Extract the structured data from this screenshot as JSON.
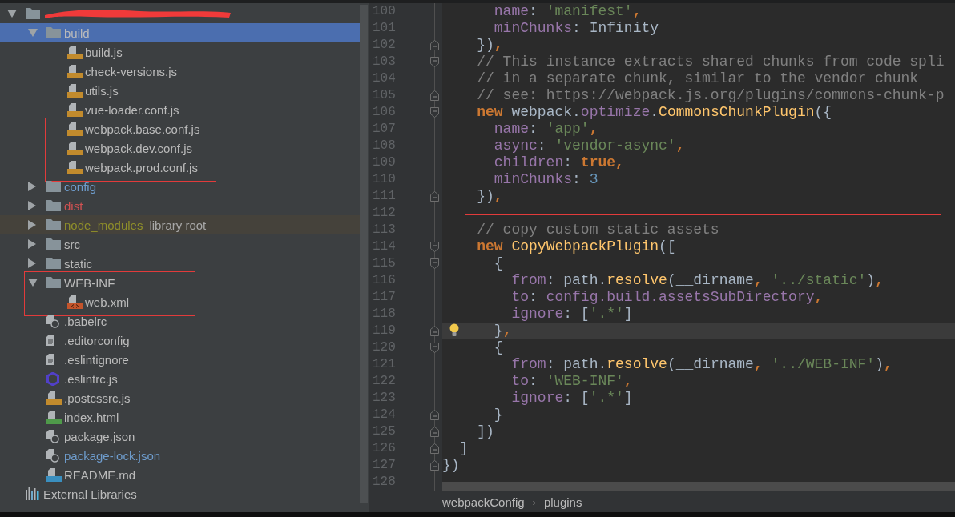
{
  "project_tree": {
    "items": [
      {
        "kind": "folder",
        "redacted": true,
        "expanded": true,
        "selected": false,
        "framed": false,
        "children": [
          {
            "kind": "folder",
            "label": "build",
            "expanded": true,
            "selected": true,
            "framed": false,
            "color": "#bbbbbb",
            "children": [
              {
                "kind": "js",
                "label": "build.js",
                "selected": false,
                "framed": false,
                "color": "#bbbbbb"
              },
              {
                "kind": "js",
                "label": "check-versions.js",
                "selected": false,
                "framed": false,
                "color": "#bbbbbb"
              },
              {
                "kind": "js",
                "label": "utils.js",
                "selected": false,
                "framed": false,
                "color": "#bbbbbb"
              },
              {
                "kind": "js",
                "label": "vue-loader.conf.js",
                "selected": false,
                "framed": false,
                "color": "#bbbbbb"
              },
              {
                "kind": "js",
                "label": "webpack.base.conf.js",
                "selected": false,
                "framed": true,
                "color": "#bbbbbb"
              },
              {
                "kind": "js",
                "label": "webpack.dev.conf.js",
                "selected": false,
                "framed": true,
                "color": "#bbbbbb"
              },
              {
                "kind": "js",
                "label": "webpack.prod.conf.js",
                "selected": false,
                "framed": true,
                "color": "#bbbbbb"
              }
            ]
          },
          {
            "kind": "folder",
            "label": "config",
            "expanded": false,
            "selected": false,
            "framed": false,
            "color": "#6e9ccc"
          },
          {
            "kind": "folder",
            "label": "dist",
            "expanded": false,
            "selected": false,
            "framed": false,
            "color": "#d25252"
          },
          {
            "kind": "folder",
            "label": "node_modules",
            "note": "library root",
            "expanded": false,
            "selected": false,
            "framed": false,
            "color": "#8f8f2a"
          },
          {
            "kind": "folder",
            "label": "src",
            "expanded": false,
            "selected": false,
            "framed": false,
            "color": "#bbbbbb"
          },
          {
            "kind": "folder",
            "label": "static",
            "expanded": false,
            "selected": false,
            "framed": false,
            "color": "#bbbbbb"
          },
          {
            "kind": "folder",
            "label": "WEB-INF",
            "expanded": true,
            "selected": false,
            "framed": true,
            "color": "#bbbbbb",
            "children": [
              {
                "kind": "xml",
                "label": "web.xml",
                "selected": false,
                "framed": true,
                "color": "#bbbbbb"
              }
            ]
          },
          {
            "kind": "config",
            "label": ".babelrc",
            "selected": false,
            "framed": false,
            "color": "#bbbbbb"
          },
          {
            "kind": "text",
            "label": ".editorconfig",
            "selected": false,
            "framed": false,
            "color": "#bbbbbb"
          },
          {
            "kind": "text",
            "label": ".eslintignore",
            "selected": false,
            "framed": false,
            "color": "#bbbbbb"
          },
          {
            "kind": "eslint",
            "label": ".eslintrc.js",
            "selected": false,
            "framed": false,
            "color": "#bbbbbb"
          },
          {
            "kind": "js",
            "label": ".postcssrc.js",
            "selected": false,
            "framed": false,
            "color": "#bbbbbb"
          },
          {
            "kind": "html",
            "label": "index.html",
            "selected": false,
            "framed": false,
            "color": "#bbbbbb"
          },
          {
            "kind": "config",
            "label": "package.json",
            "selected": false,
            "framed": false,
            "color": "#bbbbbb"
          },
          {
            "kind": "config",
            "label": "package-lock.json",
            "selected": false,
            "framed": false,
            "color": "#6e9ccc"
          },
          {
            "kind": "md",
            "label": "README.md",
            "selected": false,
            "framed": false,
            "color": "#bbbbbb"
          }
        ]
      },
      {
        "kind": "libraries",
        "label": "External Libraries",
        "selected": false,
        "framed": false,
        "color": "#bbbbbb"
      }
    ]
  },
  "editor": {
    "blocks": [
      {
        "framed": false,
        "lines": [
          {
            "n": "100",
            "fold_start": false,
            "fold_end": false,
            "current": false,
            "bulb": false,
            "code": [
              {
                "kind": "prop",
                "text": "      name"
              },
              {
                "kind": "plain",
                "text": ": "
              },
              {
                "kind": "str",
                "text": "'manifest'"
              },
              {
                "kind": "kw",
                "text": ","
              }
            ]
          },
          {
            "n": "101",
            "fold_start": false,
            "fold_end": false,
            "current": false,
            "bulb": false,
            "code": [
              {
                "kind": "prop",
                "text": "      minChunks"
              },
              {
                "kind": "plain",
                "text": ": Infinity"
              }
            ]
          },
          {
            "n": "102",
            "fold_start": false,
            "fold_end": true,
            "current": false,
            "bulb": false,
            "code": [
              {
                "kind": "plain",
                "text": "    })"
              },
              {
                "kind": "kw",
                "text": ","
              }
            ]
          },
          {
            "n": "103",
            "fold_start": true,
            "fold_end": false,
            "current": false,
            "bulb": false,
            "code": [
              {
                "kind": "cmt",
                "text": "    // This instance extracts shared chunks from code spli"
              }
            ]
          },
          {
            "n": "104",
            "fold_start": false,
            "fold_end": false,
            "current": false,
            "bulb": false,
            "code": [
              {
                "kind": "cmt",
                "text": "    // in a separate chunk, similar to the vendor chunk"
              }
            ]
          },
          {
            "n": "105",
            "fold_start": false,
            "fold_end": true,
            "current": false,
            "bulb": false,
            "code": [
              {
                "kind": "cmt",
                "text": "    // see: https://webpack.js.org/plugins/commons-chunk-p"
              }
            ]
          },
          {
            "n": "106",
            "fold_start": true,
            "fold_end": false,
            "current": false,
            "bulb": false,
            "code": [
              {
                "kind": "kw",
                "text": "    new"
              },
              {
                "kind": "plain",
                "text": " webpack."
              },
              {
                "kind": "prop",
                "text": "optimize"
              },
              {
                "kind": "plain",
                "text": "."
              },
              {
                "kind": "fn",
                "text": "CommonsChunkPlugin"
              },
              {
                "kind": "plain",
                "text": "({"
              }
            ]
          },
          {
            "n": "107",
            "fold_start": false,
            "fold_end": false,
            "current": false,
            "bulb": false,
            "code": [
              {
                "kind": "prop",
                "text": "      name"
              },
              {
                "kind": "plain",
                "text": ": "
              },
              {
                "kind": "str",
                "text": "'app'"
              },
              {
                "kind": "kw",
                "text": ","
              }
            ]
          },
          {
            "n": "108",
            "fold_start": false,
            "fold_end": false,
            "current": false,
            "bulb": false,
            "code": [
              {
                "kind": "prop",
                "text": "      async"
              },
              {
                "kind": "plain",
                "text": ": "
              },
              {
                "kind": "str",
                "text": "'vendor-async'"
              },
              {
                "kind": "kw",
                "text": ","
              }
            ]
          },
          {
            "n": "109",
            "fold_start": false,
            "fold_end": false,
            "current": false,
            "bulb": false,
            "code": [
              {
                "kind": "prop",
                "text": "      children"
              },
              {
                "kind": "plain",
                "text": ": "
              },
              {
                "kind": "kw",
                "text": "true"
              },
              {
                "kind": "kw",
                "text": ","
              }
            ]
          },
          {
            "n": "110",
            "fold_start": false,
            "fold_end": false,
            "current": false,
            "bulb": false,
            "code": [
              {
                "kind": "prop",
                "text": "      minChunks"
              },
              {
                "kind": "plain",
                "text": ": "
              },
              {
                "kind": "num",
                "text": "3"
              }
            ]
          },
          {
            "n": "111",
            "fold_start": false,
            "fold_end": true,
            "current": false,
            "bulb": false,
            "code": [
              {
                "kind": "plain",
                "text": "    })"
              },
              {
                "kind": "kw",
                "text": ","
              }
            ]
          },
          {
            "n": "112",
            "fold_start": false,
            "fold_end": false,
            "current": false,
            "bulb": false
          }
        ]
      },
      {
        "framed": true,
        "lines": [
          {
            "n": "113",
            "fold_start": false,
            "fold_end": false,
            "current": false,
            "bulb": false,
            "code": [
              {
                "kind": "cmt",
                "text": "    // copy custom static assets"
              }
            ]
          },
          {
            "n": "114",
            "fold_start": true,
            "fold_end": false,
            "current": false,
            "bulb": false,
            "code": [
              {
                "kind": "kw",
                "text": "    new"
              },
              {
                "kind": "fn",
                "text": " CopyWebpackPlugin"
              },
              {
                "kind": "plain",
                "text": "(["
              }
            ]
          },
          {
            "n": "115",
            "fold_start": true,
            "fold_end": false,
            "current": false,
            "bulb": false,
            "code": [
              {
                "kind": "plain",
                "text": "      {"
              }
            ]
          },
          {
            "n": "116",
            "fold_start": false,
            "fold_end": false,
            "current": false,
            "bulb": false,
            "code": [
              {
                "kind": "prop",
                "text": "        from"
              },
              {
                "kind": "plain",
                "text": ": path."
              },
              {
                "kind": "fn",
                "text": "resolve"
              },
              {
                "kind": "plain",
                "text": "(__dirname"
              },
              {
                "kind": "kw",
                "text": ","
              },
              {
                "kind": "str",
                "text": " '../static'"
              },
              {
                "kind": "plain",
                "text": ")"
              },
              {
                "kind": "kw",
                "text": ","
              }
            ]
          },
          {
            "n": "117",
            "fold_start": false,
            "fold_end": false,
            "current": false,
            "bulb": false,
            "code": [
              {
                "kind": "prop",
                "text": "        to"
              },
              {
                "kind": "plain",
                "text": ": "
              },
              {
                "kind": "prop",
                "text": "config.build.assetsSubDirectory"
              },
              {
                "kind": "kw",
                "text": ","
              }
            ]
          },
          {
            "n": "118",
            "fold_start": false,
            "fold_end": false,
            "current": false,
            "bulb": false,
            "code": [
              {
                "kind": "prop",
                "text": "        ignore"
              },
              {
                "kind": "plain",
                "text": ": ["
              },
              {
                "kind": "str",
                "text": "'.*'"
              },
              {
                "kind": "plain",
                "text": "]"
              }
            ]
          },
          {
            "n": "119",
            "fold_start": false,
            "fold_end": true,
            "current": true,
            "bulb": true,
            "code": [
              {
                "kind": "plain",
                "text": "      }"
              },
              {
                "kind": "kw",
                "text": ","
              }
            ]
          },
          {
            "n": "120",
            "fold_start": true,
            "fold_end": false,
            "current": false,
            "bulb": false,
            "code": [
              {
                "kind": "plain",
                "text": "      {"
              }
            ]
          },
          {
            "n": "121",
            "fold_start": false,
            "fold_end": false,
            "current": false,
            "bulb": false,
            "code": [
              {
                "kind": "prop",
                "text": "        from"
              },
              {
                "kind": "plain",
                "text": ": path."
              },
              {
                "kind": "fn",
                "text": "resolve"
              },
              {
                "kind": "plain",
                "text": "(__dirname"
              },
              {
                "kind": "kw",
                "text": ","
              },
              {
                "kind": "str",
                "text": " '../WEB-INF'"
              },
              {
                "kind": "plain",
                "text": ")"
              },
              {
                "kind": "kw",
                "text": ","
              }
            ]
          },
          {
            "n": "122",
            "fold_start": false,
            "fold_end": false,
            "current": false,
            "bulb": false,
            "code": [
              {
                "kind": "prop",
                "text": "        to"
              },
              {
                "kind": "plain",
                "text": ": "
              },
              {
                "kind": "str",
                "text": "'WEB-INF'"
              },
              {
                "kind": "kw",
                "text": ","
              }
            ]
          },
          {
            "n": "123",
            "fold_start": false,
            "fold_end": false,
            "current": false,
            "bulb": false,
            "code": [
              {
                "kind": "prop",
                "text": "        ignore"
              },
              {
                "kind": "plain",
                "text": ": ["
              },
              {
                "kind": "str",
                "text": "'.*'"
              },
              {
                "kind": "plain",
                "text": "]"
              }
            ]
          },
          {
            "n": "124",
            "fold_start": false,
            "fold_end": true,
            "current": false,
            "bulb": false,
            "code": [
              {
                "kind": "plain",
                "text": "      }"
              }
            ]
          }
        ]
      },
      {
        "framed": false,
        "lines": [
          {
            "n": "125",
            "fold_start": false,
            "fold_end": true,
            "current": false,
            "bulb": false,
            "code": [
              {
                "kind": "plain",
                "text": "    ])"
              }
            ]
          },
          {
            "n": "126",
            "fold_start": false,
            "fold_end": true,
            "current": false,
            "bulb": false,
            "code": [
              {
                "kind": "plain",
                "text": "  ]"
              }
            ]
          },
          {
            "n": "127",
            "fold_start": false,
            "fold_end": true,
            "current": false,
            "bulb": false,
            "code": [
              {
                "kind": "plain",
                "text": "})"
              }
            ]
          },
          {
            "n": "128",
            "fold_start": false,
            "fold_end": false,
            "current": false,
            "bulb": false
          }
        ]
      }
    ]
  },
  "breadcrumbs": {
    "items": [
      "webpackConfig",
      "plugins"
    ],
    "separator": "›"
  }
}
